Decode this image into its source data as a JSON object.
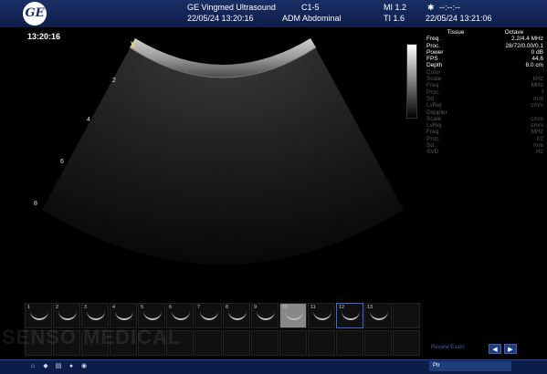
{
  "header": {
    "logo": "GE",
    "system": "GE Vingmed Ultrasound",
    "datetime_exam": "22/05/24 13:20:16",
    "probe": "C1-5",
    "preset": "ADM Abdominal",
    "mi": "MI 1.2",
    "ti": "TI 1.6",
    "clock_dashes": "--:--:--",
    "clock_datetime": "22/05/24 13:21:06"
  },
  "image": {
    "time": "13:20:16",
    "v_marker": "V",
    "depth_marks": [
      "2",
      "4",
      "6",
      "8"
    ]
  },
  "params": {
    "columns": [
      "Tissue",
      "Octave"
    ],
    "rows": [
      {
        "label": "Freq.",
        "value": "2.2/4.4",
        "unit": "MHz",
        "active": true
      },
      {
        "label": "Proc.",
        "value": "28/72/0.00/0.1",
        "unit": "",
        "active": true
      },
      {
        "label": "Power",
        "value": "0",
        "unit": "dB",
        "active": true
      },
      {
        "label": "FPS",
        "value": "44.6",
        "unit": "",
        "active": true
      },
      {
        "label": "Depth",
        "value": "8.0",
        "unit": "cm",
        "active": true
      }
    ],
    "inactive_groups": [
      {
        "title": "Color",
        "rows": [
          "Scale",
          "Freq.",
          "Proc.",
          "Sd",
          "LvRej"
        ]
      },
      {
        "title": "Doppler",
        "rows": [
          "Scale",
          "LvRej",
          "Freq.",
          "Proc.",
          "Sd",
          "SVD"
        ]
      }
    ],
    "inactive_units": [
      "kHz",
      "MHz",
      "f",
      "mm",
      "cm/s",
      "cm/s",
      "cm/s",
      "MHz",
      "f/2",
      "mm",
      "Hz"
    ]
  },
  "thumbnails": [
    {
      "num": "1"
    },
    {
      "num": "2"
    },
    {
      "num": "3"
    },
    {
      "num": "4"
    },
    {
      "num": "5"
    },
    {
      "num": "6"
    },
    {
      "num": "7"
    },
    {
      "num": "8"
    },
    {
      "num": "9"
    },
    {
      "num": "10"
    },
    {
      "num": "11"
    },
    {
      "num": "12"
    },
    {
      "num": "13"
    }
  ],
  "footer": {
    "pointer_label": "Ptr",
    "hint_label": "Review Exam",
    "prev": "◀",
    "next": "▶",
    "watermark": "SENSO MEDICAL"
  },
  "colors": {
    "accent": "#1a2f66",
    "marker": "#e8d85a",
    "selected": "#3a6fd0"
  }
}
